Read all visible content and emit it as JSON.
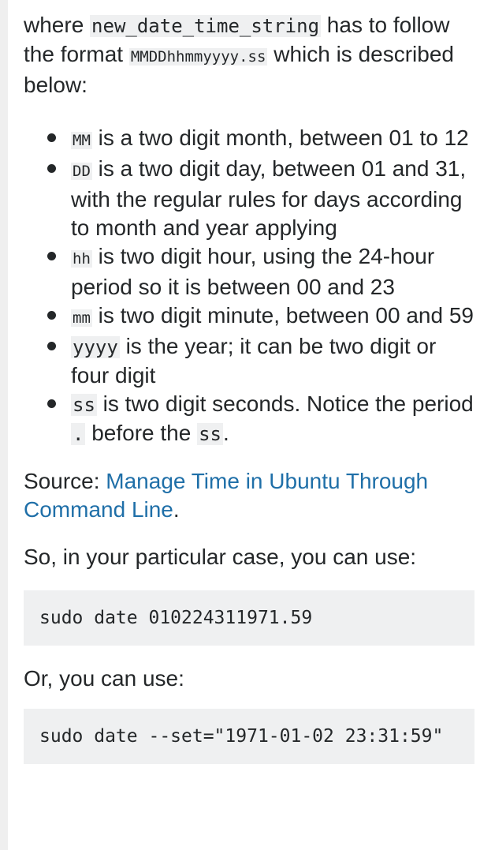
{
  "intro": {
    "pre": "where ",
    "code1": "new_date_time_string",
    "mid": " has to follow the format ",
    "code2": "MMDDhhmmyyyy.ss",
    "post": " which is described below:"
  },
  "bullets": [
    {
      "code": "MM",
      "text": " is a two digit month, between 01 to 12",
      "small": true
    },
    {
      "code": "DD",
      "text": " is a two digit day, between 01 and 31, with the regular rules for days according to month and year applying",
      "small": true
    },
    {
      "code": "hh",
      "text": " is two digit hour, using the 24-hour period so it is between 00 and 23",
      "small": true
    },
    {
      "code": "mm",
      "text": " is two digit minute, between 00 and 59",
      "small": true
    },
    {
      "code": "yyyy",
      "text": " is the year; it can be two digit or four digit",
      "small": false
    },
    {
      "code": "ss",
      "text": " is two digit seconds. Notice the period ",
      "code2": ".",
      "text2": " before the ",
      "code3": "ss",
      "text3": ".",
      "small": false
    }
  ],
  "source": {
    "label": "Source: ",
    "link_text": "Manage Time in Ubuntu Through Command Line",
    "suffix": "."
  },
  "particular_text": "So, in your particular case, you can use:",
  "code_block_1": "sudo date 010224311971.59",
  "or_text": "Or, you can use:",
  "code_block_2": "sudo date --set=\"1971-01-02 23:31:59\"",
  "colors": {
    "link": "#1f6fa8",
    "code_bg": "#eff0f1",
    "text": "#242729"
  }
}
